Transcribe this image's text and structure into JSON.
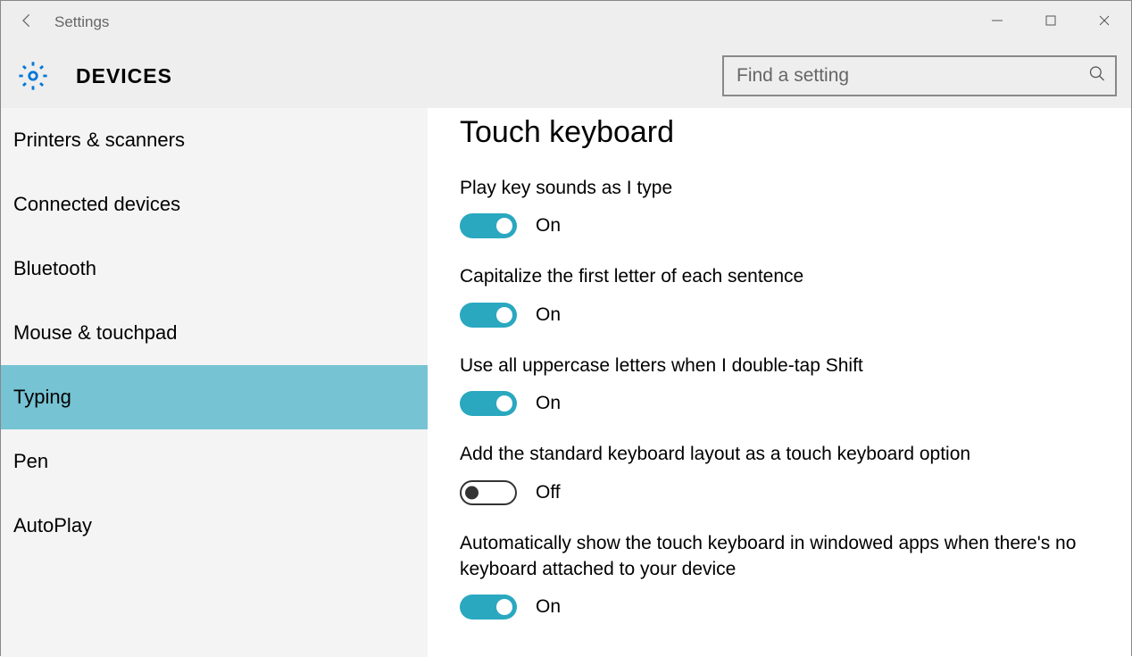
{
  "titlebar": {
    "title": "Settings"
  },
  "header": {
    "title": "DEVICES"
  },
  "search": {
    "placeholder": "Find a setting"
  },
  "sidebar": {
    "items": [
      {
        "label": "Printers & scanners",
        "selected": false
      },
      {
        "label": "Connected devices",
        "selected": false
      },
      {
        "label": "Bluetooth",
        "selected": false
      },
      {
        "label": "Mouse & touchpad",
        "selected": false
      },
      {
        "label": "Typing",
        "selected": true
      },
      {
        "label": "Pen",
        "selected": false
      },
      {
        "label": "AutoPlay",
        "selected": false
      }
    ]
  },
  "content": {
    "section_title": "Touch keyboard",
    "settings": [
      {
        "label": "Play key sounds as I type",
        "on": true,
        "state": "On"
      },
      {
        "label": "Capitalize the first letter of each sentence",
        "on": true,
        "state": "On"
      },
      {
        "label": "Use all uppercase letters when I double-tap Shift",
        "on": true,
        "state": "On"
      },
      {
        "label": "Add the standard keyboard layout as a touch keyboard option",
        "on": false,
        "state": "Off"
      },
      {
        "label": "Automatically show the touch keyboard in windowed apps when there's no keyboard attached to your device",
        "on": true,
        "state": "On"
      }
    ]
  }
}
